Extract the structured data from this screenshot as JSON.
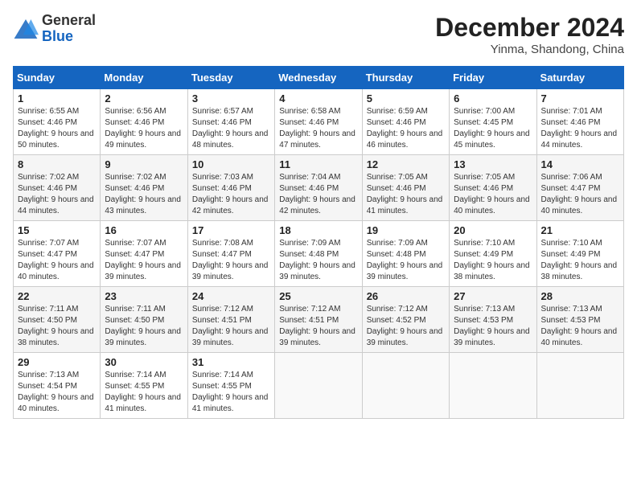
{
  "header": {
    "logo_line1": "General",
    "logo_line2": "Blue",
    "month_title": "December 2024",
    "location": "Yinma, Shandong, China"
  },
  "weekdays": [
    "Sunday",
    "Monday",
    "Tuesday",
    "Wednesday",
    "Thursday",
    "Friday",
    "Saturday"
  ],
  "weeks": [
    [
      {
        "day": "1",
        "sunrise": "6:55 AM",
        "sunset": "4:46 PM",
        "daylight": "9 hours and 50 minutes."
      },
      {
        "day": "2",
        "sunrise": "6:56 AM",
        "sunset": "4:46 PM",
        "daylight": "9 hours and 49 minutes."
      },
      {
        "day": "3",
        "sunrise": "6:57 AM",
        "sunset": "4:46 PM",
        "daylight": "9 hours and 48 minutes."
      },
      {
        "day": "4",
        "sunrise": "6:58 AM",
        "sunset": "4:46 PM",
        "daylight": "9 hours and 47 minutes."
      },
      {
        "day": "5",
        "sunrise": "6:59 AM",
        "sunset": "4:46 PM",
        "daylight": "9 hours and 46 minutes."
      },
      {
        "day": "6",
        "sunrise": "7:00 AM",
        "sunset": "4:45 PM",
        "daylight": "9 hours and 45 minutes."
      },
      {
        "day": "7",
        "sunrise": "7:01 AM",
        "sunset": "4:46 PM",
        "daylight": "9 hours and 44 minutes."
      }
    ],
    [
      {
        "day": "8",
        "sunrise": "7:02 AM",
        "sunset": "4:46 PM",
        "daylight": "9 hours and 44 minutes."
      },
      {
        "day": "9",
        "sunrise": "7:02 AM",
        "sunset": "4:46 PM",
        "daylight": "9 hours and 43 minutes."
      },
      {
        "day": "10",
        "sunrise": "7:03 AM",
        "sunset": "4:46 PM",
        "daylight": "9 hours and 42 minutes."
      },
      {
        "day": "11",
        "sunrise": "7:04 AM",
        "sunset": "4:46 PM",
        "daylight": "9 hours and 42 minutes."
      },
      {
        "day": "12",
        "sunrise": "7:05 AM",
        "sunset": "4:46 PM",
        "daylight": "9 hours and 41 minutes."
      },
      {
        "day": "13",
        "sunrise": "7:05 AM",
        "sunset": "4:46 PM",
        "daylight": "9 hours and 40 minutes."
      },
      {
        "day": "14",
        "sunrise": "7:06 AM",
        "sunset": "4:47 PM",
        "daylight": "9 hours and 40 minutes."
      }
    ],
    [
      {
        "day": "15",
        "sunrise": "7:07 AM",
        "sunset": "4:47 PM",
        "daylight": "9 hours and 40 minutes."
      },
      {
        "day": "16",
        "sunrise": "7:07 AM",
        "sunset": "4:47 PM",
        "daylight": "9 hours and 39 minutes."
      },
      {
        "day": "17",
        "sunrise": "7:08 AM",
        "sunset": "4:47 PM",
        "daylight": "9 hours and 39 minutes."
      },
      {
        "day": "18",
        "sunrise": "7:09 AM",
        "sunset": "4:48 PM",
        "daylight": "9 hours and 39 minutes."
      },
      {
        "day": "19",
        "sunrise": "7:09 AM",
        "sunset": "4:48 PM",
        "daylight": "9 hours and 39 minutes."
      },
      {
        "day": "20",
        "sunrise": "7:10 AM",
        "sunset": "4:49 PM",
        "daylight": "9 hours and 38 minutes."
      },
      {
        "day": "21",
        "sunrise": "7:10 AM",
        "sunset": "4:49 PM",
        "daylight": "9 hours and 38 minutes."
      }
    ],
    [
      {
        "day": "22",
        "sunrise": "7:11 AM",
        "sunset": "4:50 PM",
        "daylight": "9 hours and 38 minutes."
      },
      {
        "day": "23",
        "sunrise": "7:11 AM",
        "sunset": "4:50 PM",
        "daylight": "9 hours and 39 minutes."
      },
      {
        "day": "24",
        "sunrise": "7:12 AM",
        "sunset": "4:51 PM",
        "daylight": "9 hours and 39 minutes."
      },
      {
        "day": "25",
        "sunrise": "7:12 AM",
        "sunset": "4:51 PM",
        "daylight": "9 hours and 39 minutes."
      },
      {
        "day": "26",
        "sunrise": "7:12 AM",
        "sunset": "4:52 PM",
        "daylight": "9 hours and 39 minutes."
      },
      {
        "day": "27",
        "sunrise": "7:13 AM",
        "sunset": "4:53 PM",
        "daylight": "9 hours and 39 minutes."
      },
      {
        "day": "28",
        "sunrise": "7:13 AM",
        "sunset": "4:53 PM",
        "daylight": "9 hours and 40 minutes."
      }
    ],
    [
      {
        "day": "29",
        "sunrise": "7:13 AM",
        "sunset": "4:54 PM",
        "daylight": "9 hours and 40 minutes."
      },
      {
        "day": "30",
        "sunrise": "7:14 AM",
        "sunset": "4:55 PM",
        "daylight": "9 hours and 41 minutes."
      },
      {
        "day": "31",
        "sunrise": "7:14 AM",
        "sunset": "4:55 PM",
        "daylight": "9 hours and 41 minutes."
      },
      null,
      null,
      null,
      null
    ]
  ]
}
